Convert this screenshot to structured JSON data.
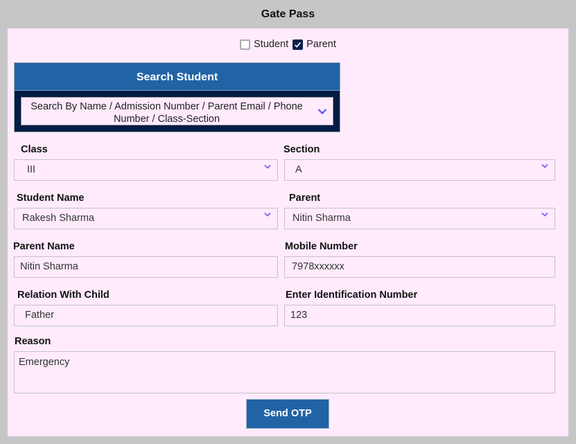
{
  "header": {
    "title": "Gate Pass"
  },
  "mode_checkboxes": [
    {
      "label": "Student",
      "checked": false
    },
    {
      "label": "Parent",
      "checked": true
    }
  ],
  "search": {
    "heading": "Search Student",
    "placeholder": "Search By Name / Admission Number / Parent Email / Phone Number / Class-Section"
  },
  "form": {
    "class": {
      "label": "Class",
      "value": "III"
    },
    "section": {
      "label": "Section",
      "value": "A"
    },
    "student_name": {
      "label": "Student Name",
      "value": "Rakesh Sharma"
    },
    "parent": {
      "label": "Parent",
      "value": "Nitin Sharma"
    },
    "parent_name": {
      "label": "Parent Name",
      "value": "Nitin Sharma"
    },
    "mobile_number": {
      "label": "Mobile Number",
      "value": "7978xxxxxx"
    },
    "relation": {
      "label": "Relation With Child",
      "value": "Father"
    },
    "identification": {
      "label": "Enter Identification Number",
      "value": "123"
    },
    "reason": {
      "label": "Reason",
      "value": "Emergency"
    }
  },
  "actions": {
    "send_otp": "Send OTP"
  },
  "colors": {
    "background": "#c6c6c6",
    "panel": "#ffebfc",
    "primary": "#2163a5",
    "navy": "#031c45",
    "chevron": "#6a5cf0"
  }
}
